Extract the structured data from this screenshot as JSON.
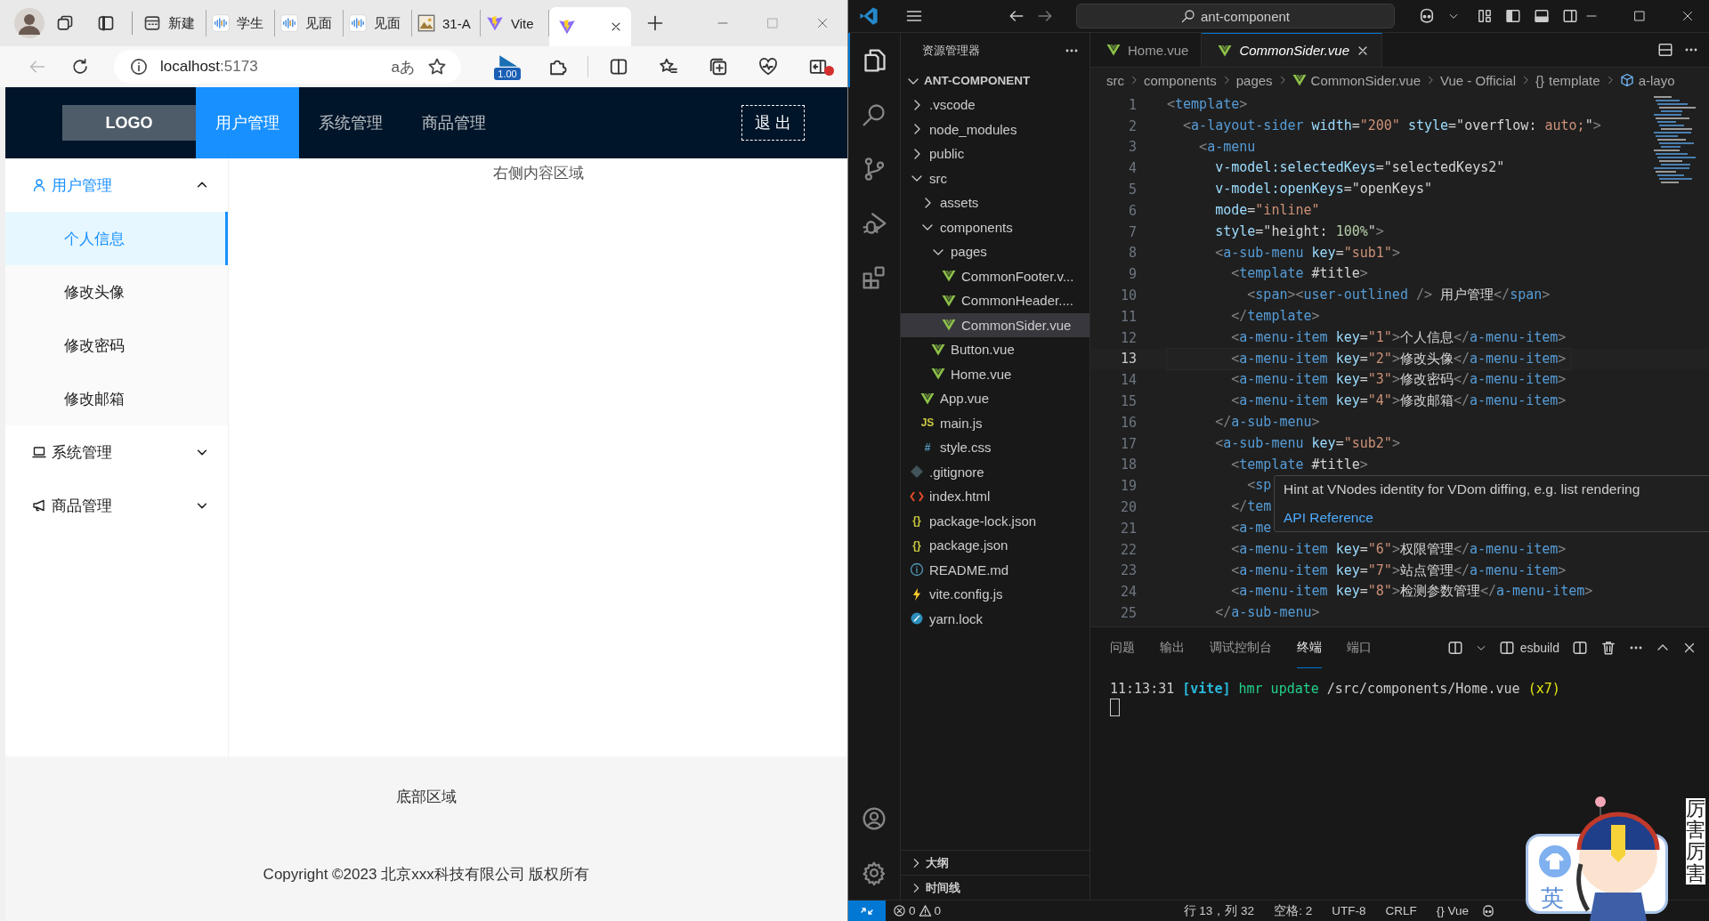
{
  "browser": {
    "tabs": [
      {
        "label": "新建",
        "kind": "calendar",
        "selected": false
      },
      {
        "label": "学生",
        "kind": "audio",
        "selected": false
      },
      {
        "label": "见面",
        "kind": "audio",
        "selected": false
      },
      {
        "label": "见面",
        "kind": "audio",
        "selected": false
      },
      {
        "label": "31-A",
        "kind": "image",
        "selected": false
      },
      {
        "label": "Vite",
        "kind": "vite",
        "selected": false
      },
      {
        "kind": "vite",
        "selected": true
      }
    ],
    "address": {
      "host": "localhost",
      "port": ":5173"
    },
    "read_aloud": "aあ",
    "media_badge": "1.00"
  },
  "app": {
    "logo": "LOGO",
    "nav": [
      {
        "label": "用户管理",
        "selected": true
      },
      {
        "label": "系统管理",
        "selected": false
      },
      {
        "label": "商品管理",
        "selected": false
      }
    ],
    "logout": "退 出",
    "menu": [
      {
        "title": "用户管理",
        "kind": "user",
        "expanded": true,
        "items": [
          {
            "label": "个人信息",
            "selected": true
          },
          {
            "label": "修改头像",
            "selected": false
          },
          {
            "label": "修改密码",
            "selected": false
          },
          {
            "label": "修改邮箱",
            "selected": false
          }
        ]
      },
      {
        "title": "系统管理",
        "kind": "laptop",
        "expanded": false
      },
      {
        "title": "商品管理",
        "kind": "megaphone",
        "expanded": false
      }
    ],
    "content": "右侧内容区域",
    "footer": {
      "title": "底部区域",
      "copyright": "Copyright ©2023 北京xxx科技有限公司 版权所有"
    }
  },
  "vscode": {
    "search": "ant-component",
    "explorer": {
      "title": "资源管理器",
      "root": "ANT-COMPONENT",
      "tree": [
        {
          "name": ".vscode",
          "kind": "folder",
          "expanded": false,
          "selected": false
        },
        {
          "name": "node_modules",
          "kind": "folder",
          "expanded": false,
          "selected": false
        },
        {
          "name": "public",
          "kind": "folder",
          "expanded": false,
          "selected": false
        },
        {
          "name": "src",
          "kind": "folder",
          "expanded": true,
          "selected": false,
          "children": [
            {
              "name": "assets",
              "kind": "folder",
              "expanded": false,
              "selected": false
            },
            {
              "name": "components",
              "kind": "folder",
              "expanded": true,
              "selected": false,
              "children": [
                {
                  "name": "pages",
                  "kind": "folder",
                  "expanded": true,
                  "selected": false,
                  "children": [
                    {
                      "name": "CommonFooter.v...",
                      "kind": "vue",
                      "selected": false
                    },
                    {
                      "name": "CommonHeader....",
                      "kind": "vue",
                      "selected": false
                    },
                    {
                      "name": "CommonSider.vue",
                      "kind": "vue",
                      "selected": true
                    }
                  ]
                },
                {
                  "name": "Button.vue",
                  "kind": "vue",
                  "selected": false
                },
                {
                  "name": "Home.vue",
                  "kind": "vue",
                  "selected": false
                }
              ]
            },
            {
              "name": "App.vue",
              "kind": "vue",
              "selected": false
            },
            {
              "name": "main.js",
              "kind": "js",
              "glyph": "JS",
              "selected": false
            },
            {
              "name": "style.css",
              "kind": "css",
              "glyph": "#",
              "selected": false
            }
          ]
        },
        {
          "name": ".gitignore",
          "kind": "git",
          "selected": false
        },
        {
          "name": "index.html",
          "kind": "html",
          "selected": false
        },
        {
          "name": "package-lock.json",
          "kind": "json",
          "glyph": "{}",
          "selected": false
        },
        {
          "name": "package.json",
          "kind": "json",
          "glyph": "{}",
          "selected": false
        },
        {
          "name": "README.md",
          "kind": "info",
          "selected": false
        },
        {
          "name": "vite.config.js",
          "kind": "bolt",
          "selected": false
        },
        {
          "name": "yarn.lock",
          "kind": "yarn",
          "selected": false
        }
      ],
      "sections": [
        {
          "label": "大纲",
          "expanded": false
        },
        {
          "label": "时间线",
          "expanded": false
        }
      ]
    },
    "tabs": [
      {
        "label": "Home.vue",
        "selected": false
      },
      {
        "label": "CommonSider.vue",
        "selected": true
      }
    ],
    "breadcrumbs": [
      {
        "label": "src",
        "kind": "plain"
      },
      {
        "label": "components",
        "kind": "plain"
      },
      {
        "label": "pages",
        "kind": "plain"
      },
      {
        "label": "CommonSider.vue",
        "kind": "vue"
      },
      {
        "label": "Vue - Official",
        "kind": "plain"
      },
      {
        "label": "template",
        "kind": "braces",
        "glyph": "{}"
      },
      {
        "label": "a-layo",
        "kind": "cube"
      }
    ],
    "code": [
      {
        "no": "1",
        "selected": false,
        "tokens": [
          {
            "kind": "p",
            "text": "<"
          },
          {
            "kind": "tag",
            "text": "template"
          },
          {
            "kind": "p",
            "text": ">"
          }
        ]
      },
      {
        "no": "2",
        "selected": false,
        "tokens": [
          {
            "kind": "p",
            "text": "  <"
          },
          {
            "kind": "tag",
            "text": "a-layout-sider"
          },
          {
            "kind": "attr",
            "text": " width"
          },
          {
            "kind": "op",
            "text": "="
          },
          {
            "kind": "str",
            "text": "\"200\""
          },
          {
            "kind": "attr",
            "text": " style"
          },
          {
            "kind": "op",
            "text": "=\"overflow: "
          },
          {
            "kind": "str",
            "text": "auto;"
          },
          {
            "kind": "op",
            "text": "\""
          },
          {
            "kind": "p",
            "text": ">"
          }
        ]
      },
      {
        "no": "3",
        "selected": false,
        "tokens": [
          {
            "kind": "p",
            "text": "    <"
          },
          {
            "kind": "tag",
            "text": "a-menu"
          }
        ]
      },
      {
        "no": "4",
        "selected": false,
        "tokens": [
          {
            "kind": "attr",
            "text": "      v-model:selectedKeys"
          },
          {
            "kind": "op",
            "text": "="
          },
          {
            "kind": "text",
            "text": "\"selectedKeys2\""
          }
        ]
      },
      {
        "no": "5",
        "selected": false,
        "tokens": [
          {
            "kind": "attr",
            "text": "      v-model:openKeys"
          },
          {
            "kind": "op",
            "text": "="
          },
          {
            "kind": "text",
            "text": "\"openKeys\""
          }
        ]
      },
      {
        "no": "6",
        "selected": false,
        "tokens": [
          {
            "kind": "attr",
            "text": "      mode"
          },
          {
            "kind": "op",
            "text": "="
          },
          {
            "kind": "str",
            "text": "\"inline\""
          }
        ]
      },
      {
        "no": "7",
        "selected": false,
        "tokens": [
          {
            "kind": "attr",
            "text": "      style"
          },
          {
            "kind": "op",
            "text": "=\"height: "
          },
          {
            "kind": "num",
            "text": "100%"
          },
          {
            "kind": "op",
            "text": "\""
          },
          {
            "kind": "p",
            "text": ">"
          }
        ]
      },
      {
        "no": "8",
        "selected": false,
        "tokens": [
          {
            "kind": "p",
            "text": "      <"
          },
          {
            "kind": "tag",
            "text": "a-sub-menu"
          },
          {
            "kind": "attr",
            "text": " key"
          },
          {
            "kind": "op",
            "text": "="
          },
          {
            "kind": "str",
            "text": "\"sub1\""
          },
          {
            "kind": "p",
            "text": ">"
          }
        ]
      },
      {
        "no": "9",
        "selected": false,
        "tokens": [
          {
            "kind": "p",
            "text": "        <"
          },
          {
            "kind": "tag",
            "text": "template"
          },
          {
            "kind": "text",
            "text": " #title"
          },
          {
            "kind": "p",
            "text": ">"
          }
        ]
      },
      {
        "no": "10",
        "selected": false,
        "tokens": [
          {
            "kind": "p",
            "text": "          <"
          },
          {
            "kind": "tag",
            "text": "span"
          },
          {
            "kind": "p",
            "text": "><"
          },
          {
            "kind": "tag",
            "text": "user-outlined"
          },
          {
            "kind": "p",
            "text": " />"
          },
          {
            "kind": "text",
            "text": " 用户管理"
          },
          {
            "kind": "p",
            "text": "</"
          },
          {
            "kind": "tag",
            "text": "span"
          },
          {
            "kind": "p",
            "text": ">"
          }
        ]
      },
      {
        "no": "11",
        "selected": false,
        "tokens": [
          {
            "kind": "p",
            "text": "        </"
          },
          {
            "kind": "tag",
            "text": "template"
          },
          {
            "kind": "p",
            "text": ">"
          }
        ]
      },
      {
        "no": "12",
        "selected": false,
        "tokens": [
          {
            "kind": "p",
            "text": "        <"
          },
          {
            "kind": "tag",
            "text": "a-menu-item"
          },
          {
            "kind": "attr",
            "text": " key"
          },
          {
            "kind": "op",
            "text": "="
          },
          {
            "kind": "str",
            "text": "\"1\""
          },
          {
            "kind": "p",
            "text": ">"
          },
          {
            "kind": "text",
            "text": "个人信息"
          },
          {
            "kind": "p",
            "text": "</"
          },
          {
            "kind": "tag",
            "text": "a-menu-item"
          },
          {
            "kind": "p",
            "text": ">"
          }
        ]
      },
      {
        "no": "13",
        "selected": true,
        "tokens": [
          {
            "kind": "p",
            "text": "        <"
          },
          {
            "kind": "tag",
            "text": "a-menu-item"
          },
          {
            "kind": "attr",
            "text": " key"
          },
          {
            "kind": "op",
            "text": "="
          },
          {
            "kind": "str",
            "text": "\"2\""
          },
          {
            "kind": "p",
            "text": ">"
          },
          {
            "kind": "text",
            "text": "修改头像"
          },
          {
            "kind": "p",
            "text": "</"
          },
          {
            "kind": "tag",
            "text": "a-menu-item"
          },
          {
            "kind": "p",
            "text": ">"
          }
        ]
      },
      {
        "no": "14",
        "selected": false,
        "tokens": [
          {
            "kind": "p",
            "text": "        <"
          },
          {
            "kind": "tag",
            "text": "a-menu-item"
          },
          {
            "kind": "attr",
            "text": " key"
          },
          {
            "kind": "op",
            "text": "="
          },
          {
            "kind": "str",
            "text": "\"3\""
          },
          {
            "kind": "p",
            "text": ">"
          },
          {
            "kind": "text",
            "text": "修改密码"
          },
          {
            "kind": "p",
            "text": "</"
          },
          {
            "kind": "tag",
            "text": "a-menu-item"
          },
          {
            "kind": "p",
            "text": ">"
          }
        ]
      },
      {
        "no": "15",
        "selected": false,
        "tokens": [
          {
            "kind": "p",
            "text": "        <"
          },
          {
            "kind": "tag",
            "text": "a-menu-item"
          },
          {
            "kind": "attr",
            "text": " key"
          },
          {
            "kind": "op",
            "text": "="
          },
          {
            "kind": "str",
            "text": "\"4\""
          },
          {
            "kind": "p",
            "text": ">"
          },
          {
            "kind": "text",
            "text": "修改邮箱"
          },
          {
            "kind": "p",
            "text": "</"
          },
          {
            "kind": "tag",
            "text": "a-menu-item"
          },
          {
            "kind": "p",
            "text": ">"
          }
        ]
      },
      {
        "no": "16",
        "selected": false,
        "tokens": [
          {
            "kind": "p",
            "text": "      </"
          },
          {
            "kind": "tag",
            "text": "a-sub-menu"
          },
          {
            "kind": "p",
            "text": ">"
          }
        ]
      },
      {
        "no": "17",
        "selected": false,
        "tokens": [
          {
            "kind": "p",
            "text": "      <"
          },
          {
            "kind": "tag",
            "text": "a-sub-menu"
          },
          {
            "kind": "attr",
            "text": " key"
          },
          {
            "kind": "op",
            "text": "="
          },
          {
            "kind": "str",
            "text": "\"sub2\""
          },
          {
            "kind": "p",
            "text": ">"
          }
        ]
      },
      {
        "no": "18",
        "selected": false,
        "tokens": [
          {
            "kind": "p",
            "text": "        <"
          },
          {
            "kind": "tag",
            "text": "template"
          },
          {
            "kind": "text",
            "text": " #title"
          },
          {
            "kind": "p",
            "text": ">"
          }
        ]
      },
      {
        "no": "19",
        "selected": false,
        "tokens": [
          {
            "kind": "p",
            "text": "          <"
          },
          {
            "kind": "tag",
            "text": "sp"
          }
        ]
      },
      {
        "no": "20",
        "selected": false,
        "tokens": [
          {
            "kind": "p",
            "text": "        </"
          },
          {
            "kind": "tag",
            "text": "tem"
          }
        ]
      },
      {
        "no": "21",
        "selected": false,
        "tokens": [
          {
            "kind": "p",
            "text": "        <"
          },
          {
            "kind": "tag",
            "text": "a-me"
          }
        ]
      },
      {
        "no": "22",
        "selected": false,
        "tokens": [
          {
            "kind": "p",
            "text": "        <"
          },
          {
            "kind": "tag",
            "text": "a-menu-item"
          },
          {
            "kind": "attr",
            "text": " key"
          },
          {
            "kind": "op",
            "text": "="
          },
          {
            "kind": "str",
            "text": "\"6\""
          },
          {
            "kind": "p",
            "text": ">"
          },
          {
            "kind": "text",
            "text": "权限管理"
          },
          {
            "kind": "p",
            "text": "</"
          },
          {
            "kind": "tag",
            "text": "a-menu-item"
          },
          {
            "kind": "p",
            "text": ">"
          }
        ]
      },
      {
        "no": "23",
        "selected": false,
        "tokens": [
          {
            "kind": "p",
            "text": "        <"
          },
          {
            "kind": "tag",
            "text": "a-menu-item"
          },
          {
            "kind": "attr",
            "text": " key"
          },
          {
            "kind": "op",
            "text": "="
          },
          {
            "kind": "str",
            "text": "\"7\""
          },
          {
            "kind": "p",
            "text": ">"
          },
          {
            "kind": "text",
            "text": "站点管理"
          },
          {
            "kind": "p",
            "text": "</"
          },
          {
            "kind": "tag",
            "text": "a-menu-item"
          },
          {
            "kind": "p",
            "text": ">"
          }
        ]
      },
      {
        "no": "24",
        "selected": false,
        "tokens": [
          {
            "kind": "p",
            "text": "        <"
          },
          {
            "kind": "tag",
            "text": "a-menu-item"
          },
          {
            "kind": "attr",
            "text": " key"
          },
          {
            "kind": "op",
            "text": "="
          },
          {
            "kind": "str",
            "text": "\"8\""
          },
          {
            "kind": "p",
            "text": ">"
          },
          {
            "kind": "text",
            "text": "检测参数管理"
          },
          {
            "kind": "p",
            "text": "</"
          },
          {
            "kind": "tag",
            "text": "a-menu-item"
          },
          {
            "kind": "p",
            "text": ">"
          }
        ]
      },
      {
        "no": "25",
        "selected": false,
        "tokens": [
          {
            "kind": "p",
            "text": "      </"
          },
          {
            "kind": "tag",
            "text": "a-sub-menu"
          },
          {
            "kind": "p",
            "text": ">"
          }
        ]
      }
    ],
    "tooltip": {
      "text": "Hint at VNodes identity for VDom diffing, e.g. list rendering",
      "link": "API Reference"
    },
    "panel": {
      "tabs": [
        {
          "label": "问题",
          "selected": false
        },
        {
          "label": "输出",
          "selected": false
        },
        {
          "label": "调试控制台",
          "selected": false
        },
        {
          "label": "终端",
          "selected": true
        },
        {
          "label": "端口",
          "selected": false
        }
      ],
      "terminal_name": "esbuild",
      "output": [
        {
          "kind": "text",
          "text": "11:13:31 "
        },
        {
          "kind": "cyan",
          "text": "[vite]"
        },
        {
          "kind": "green",
          "text": " hmr update"
        },
        {
          "kind": "text",
          "text": " /src/components/Home.vue "
        },
        {
          "kind": "yellow",
          "text": "(x7)"
        }
      ]
    },
    "status": {
      "errors": "0",
      "warnings": "0",
      "position": "行 13，列 32",
      "indent": "空格: 2",
      "encoding": "UTF-8",
      "eol": "CRLF",
      "lang_glyph": "{}",
      "language": "Vue"
    }
  },
  "ime": {
    "mode": "英",
    "caption": "厉害厉害"
  }
}
